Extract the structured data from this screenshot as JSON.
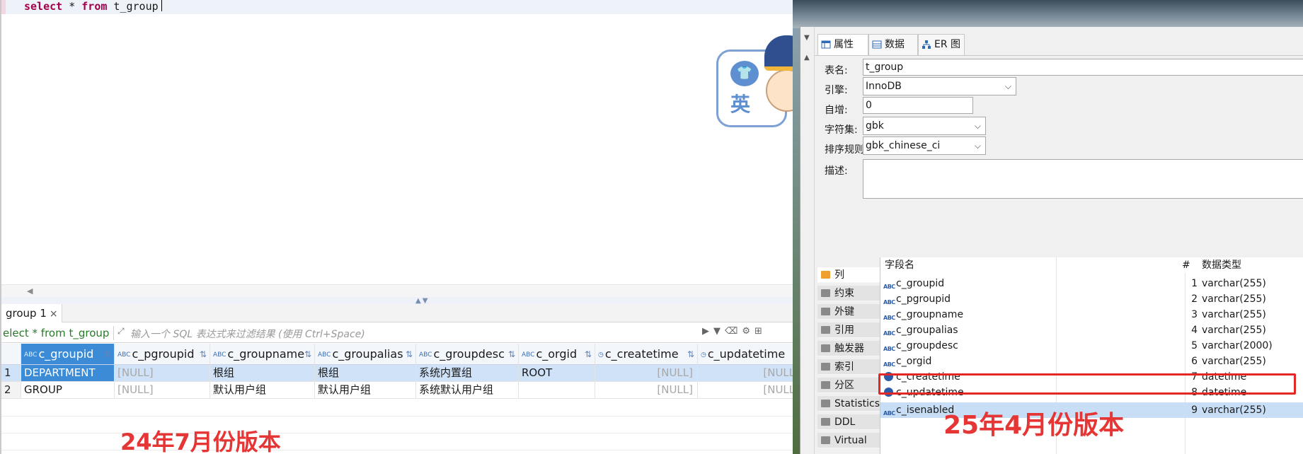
{
  "editor": {
    "sql_kw1": "select",
    "sql_mid": " * ",
    "sql_kw2": "from",
    "sql_table": " t_group"
  },
  "results_tab": {
    "label": "group 1",
    "close": "×"
  },
  "filter": {
    "query": "elect * from t_group",
    "placeholder": "输入一个 SQL 表达式来过滤结果 (使用 Ctrl+Space)"
  },
  "mascot": {
    "ying": "英",
    "shirt": "👕"
  },
  "grid": {
    "columns": [
      "c_groupid",
      "c_pgroupid",
      "c_groupname",
      "c_groupalias",
      "c_groupdesc",
      "c_orgid",
      "c_createtime",
      "c_updatetime"
    ],
    "rows": [
      {
        "num": "1",
        "cells": [
          "DEPARTMENT",
          "[NULL]",
          "根组",
          "根组",
          "系统内置组",
          "ROOT",
          "[NULL]",
          "[NULL]"
        ]
      },
      {
        "num": "2",
        "cells": [
          "GROUP",
          "[NULL]",
          "默认用户组",
          "默认用户组",
          "系统默认用户组",
          "",
          "[NULL]",
          "[NULL]"
        ]
      }
    ]
  },
  "note_left": "24年7月份版本",
  "right": {
    "tabs": [
      "属性",
      "数据",
      "ER 图"
    ],
    "props": {
      "table_name_label": "表名:",
      "table_name": "t_group",
      "engine_label": "引擎:",
      "engine": "InnoDB",
      "auto_inc_label": "自增:",
      "auto_inc": "0",
      "charset_label": "字符集:",
      "charset": "gbk",
      "collation_label": "排序规则:",
      "collation": "gbk_chinese_ci",
      "desc_label": "描述:"
    },
    "side_items": [
      "列",
      "约束",
      "外键",
      "引用",
      "触发器",
      "索引",
      "分区",
      "Statistics",
      "DDL",
      "Virtual"
    ],
    "col_headers": {
      "name": "字段名",
      "num": "#",
      "type": "数据类型"
    },
    "columns": [
      {
        "name": "c_groupid",
        "num": "1",
        "type": "varchar(255)",
        "icon": "abc"
      },
      {
        "name": "c_pgroupid",
        "num": "2",
        "type": "varchar(255)",
        "icon": "abc"
      },
      {
        "name": "c_groupname",
        "num": "3",
        "type": "varchar(255)",
        "icon": "abc"
      },
      {
        "name": "c_groupalias",
        "num": "4",
        "type": "varchar(255)",
        "icon": "abc"
      },
      {
        "name": "c_groupdesc",
        "num": "5",
        "type": "varchar(2000)",
        "icon": "abc"
      },
      {
        "name": "c_orgid",
        "num": "6",
        "type": "varchar(255)",
        "icon": "abc"
      },
      {
        "name": "c_createtime",
        "num": "7",
        "type": "datetime",
        "icon": "clock"
      },
      {
        "name": "c_updatetime",
        "num": "8",
        "type": "datetime",
        "icon": "clock"
      },
      {
        "name": "c_isenabled",
        "num": "9",
        "type": "varchar(255)",
        "icon": "abc"
      }
    ]
  },
  "note_right": "25年4月份版本"
}
